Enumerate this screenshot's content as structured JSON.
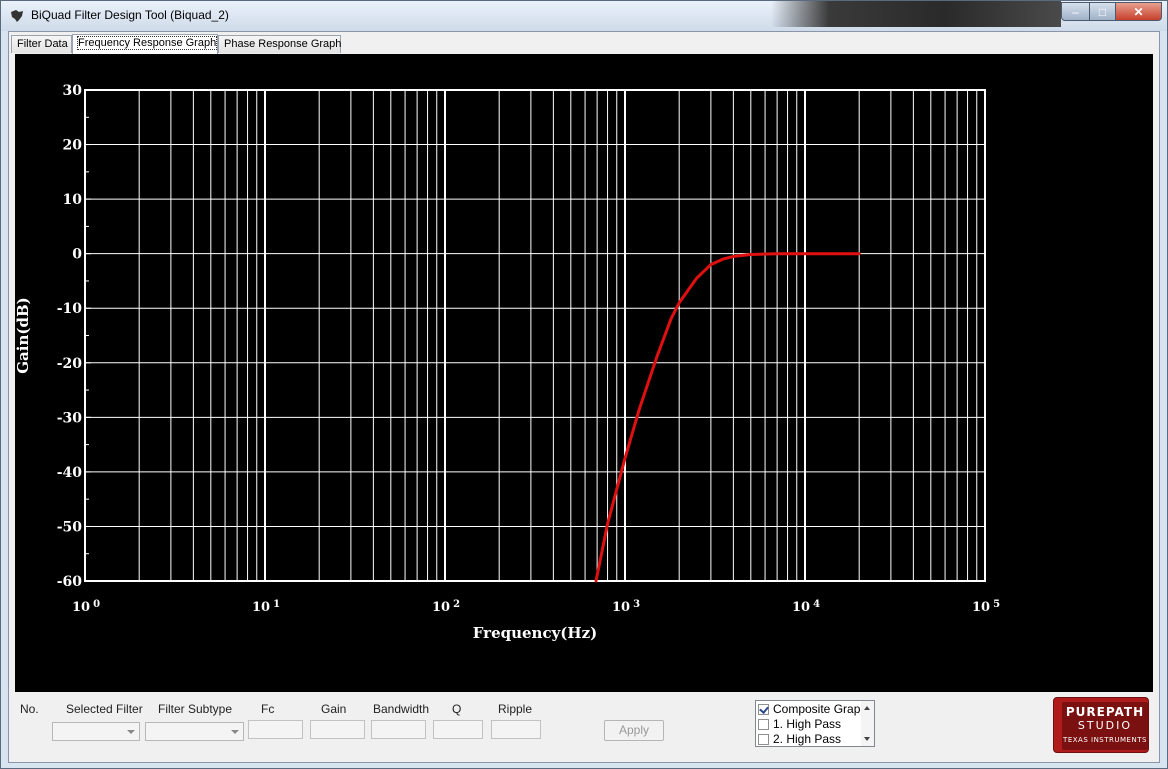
{
  "window": {
    "title": "BiQuad Filter Design Tool (Biquad_2)",
    "controls": {
      "minimize": "–",
      "maximize": "□",
      "close": "✕"
    }
  },
  "tabs": [
    {
      "label": "Filter Data",
      "active": false
    },
    {
      "label": "Frequency Response Graph",
      "active": true
    },
    {
      "label": "Phase Response Graph",
      "active": false
    }
  ],
  "chart_data": {
    "type": "line",
    "title": "",
    "xlabel": "Frequency(Hz)",
    "ylabel": "Gain(dB)",
    "x_scale": "log",
    "xlim": [
      1,
      100000
    ],
    "ylim": [
      -60,
      30
    ],
    "x_ticks": [
      {
        "base": "10",
        "exp": "0"
      },
      {
        "base": "10",
        "exp": "1"
      },
      {
        "base": "10",
        "exp": "2"
      },
      {
        "base": "10",
        "exp": "3"
      },
      {
        "base": "10",
        "exp": "4"
      },
      {
        "base": "10",
        "exp": "5"
      }
    ],
    "y_ticks": [
      "30",
      "20",
      "10",
      "0",
      "-10",
      "-20",
      "-30",
      "-40",
      "-50",
      "-60"
    ],
    "grid": true,
    "background": "#000000",
    "grid_color": "#ffffff",
    "series": [
      {
        "color": "#e01010",
        "x": [
          690,
          800,
          1000,
          1200,
          1500,
          1800,
          2000,
          2500,
          3000,
          3500,
          4000,
          5000,
          7000,
          10000,
          15000,
          20000
        ],
        "y": [
          -60,
          -49.5,
          -37.5,
          -28.5,
          -19,
          -12,
          -9,
          -4.5,
          -2,
          -1,
          -0.5,
          -0.15,
          0,
          0,
          0,
          0
        ]
      }
    ]
  },
  "bottom": {
    "labels": {
      "no": "No.",
      "selected_filter": "Selected Filter",
      "filter_subtype": "Filter Subtype",
      "fc": "Fc",
      "gain": "Gain",
      "bandwidth": "Bandwidth",
      "q": "Q",
      "ripple": "Ripple"
    },
    "apply_label": "Apply",
    "checklist": [
      {
        "label": "Composite Grap",
        "checked": true
      },
      {
        "label": "1. High Pass",
        "checked": false
      },
      {
        "label": "2. High Pass",
        "checked": false
      }
    ]
  },
  "logo": {
    "line1": "PUREPATH",
    "line2": "STUDIO",
    "line3": "TEXAS INSTRUMENTS"
  }
}
